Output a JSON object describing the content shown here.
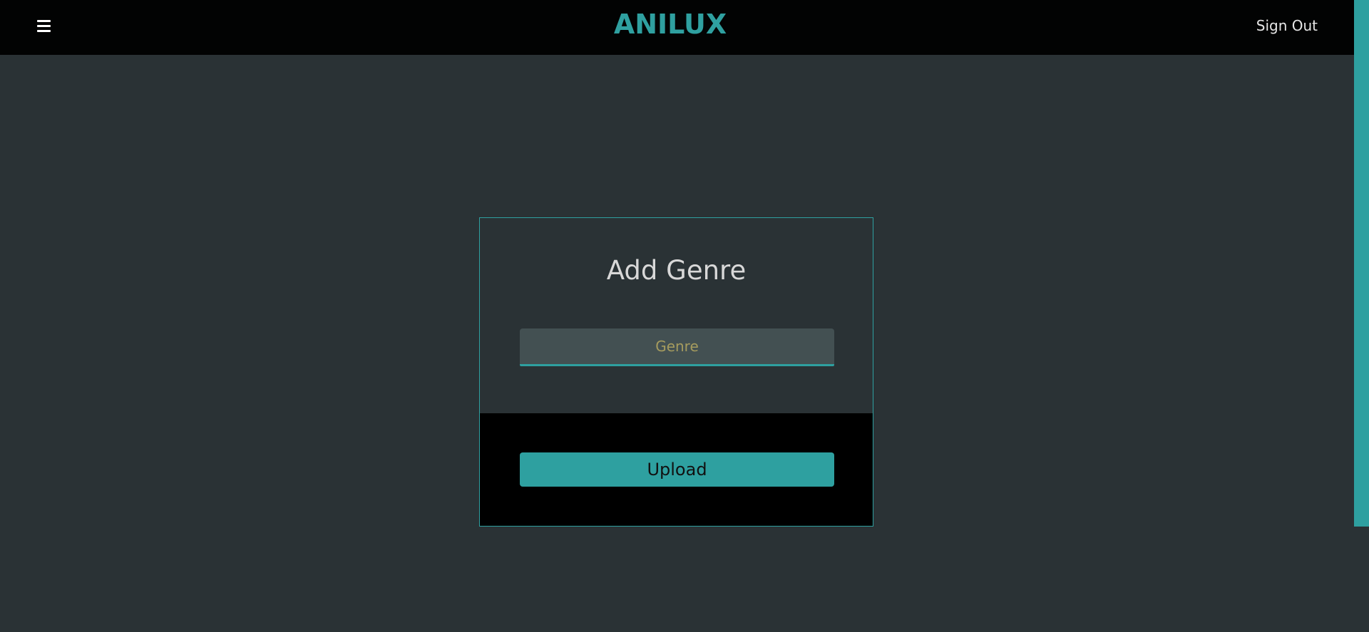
{
  "header": {
    "brand": "ANILUX",
    "menu_icon": "hamburger-menu-icon",
    "sign_out_label": "Sign Out"
  },
  "form": {
    "title": "Add Genre",
    "genre_placeholder": "Genre",
    "genre_value": "",
    "upload_label": "Upload"
  },
  "colors": {
    "accent": "#2ea0a0",
    "background": "#2a3235",
    "header_bg": "#020303",
    "input_bg": "#435052",
    "placeholder": "#a59b5e"
  }
}
